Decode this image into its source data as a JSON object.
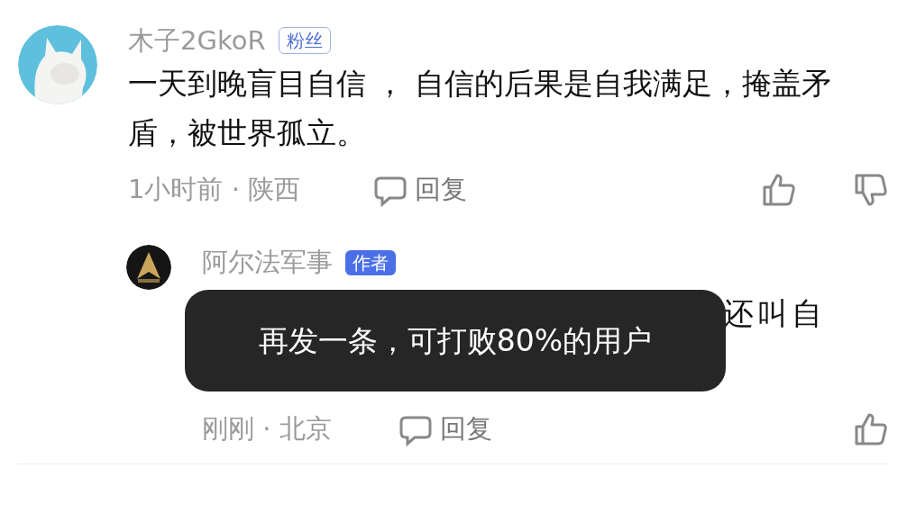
{
  "comments": [
    {
      "username": "木子2GkoR",
      "badge": {
        "text": "粉丝",
        "kind": "fan"
      },
      "text": "一天到晚盲目自信 ， 自信的后果是自我满足，掩盖矛盾，被世界孤立。",
      "time": "1小时前 · 陕西",
      "reply_label": "回复",
      "dislike": true,
      "replies": [
        {
          "username": "阿尔法军事",
          "badge": {
            "text": "作者",
            "kind": "author"
          },
          "text": "还叫自",
          "time": "刚刚 · 北京",
          "reply_label": "回复",
          "dislike": false
        }
      ]
    }
  ],
  "toast": {
    "text": "再发一条，可打败80%的用户"
  }
}
